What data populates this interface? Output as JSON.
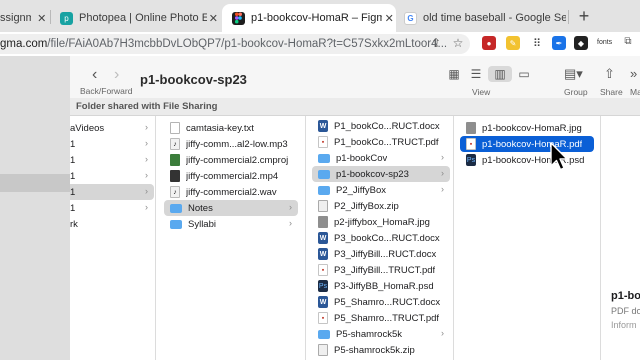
{
  "browser": {
    "tabs": [
      {
        "title": "ssignm",
        "favicon": "page-icon",
        "active": false
      },
      {
        "title": "Photopea | Online Photo Editor",
        "favicon": "photopea-icon",
        "active": false
      },
      {
        "title": "p1-bookcov-HomaR – Figma",
        "favicon": "figma-icon",
        "active": true
      },
      {
        "title": "old time baseball - Google Sea",
        "favicon": "google-icon",
        "active": false
      }
    ],
    "close_glyph": "✕",
    "new_tab_glyph": "+",
    "address": {
      "host": "gma.com",
      "path": "/file/FAiA0Ab7H3mcbbDvLObQP7/p1-bookcov-HomaR?t=C57Sxkx2mLtoor4..."
    },
    "fonts_label": "fonts"
  },
  "finder": {
    "window_title": "p1-bookcov-sp23",
    "back_forward_label": "Back/Forward",
    "view_label": "View",
    "group_label": "Group",
    "share_label": "Share",
    "more_label": "Ma",
    "shared_banner": "Folder shared with File Sharing",
    "sidebar_items": [
      "aVideos",
      "1",
      "1",
      "1",
      "1",
      "1",
      "rk"
    ],
    "column1": [
      {
        "name": "camtasia-key.txt",
        "icon": "text-file-icon"
      },
      {
        "name": "jiffy-comm...al2-low.mp3",
        "icon": "audio-file-icon"
      },
      {
        "name": "jiffy-commercial2.cmproj",
        "icon": "project-file-icon"
      },
      {
        "name": "jiffy-commercial2.mp4",
        "icon": "video-file-icon"
      },
      {
        "name": "jiffy-commercial2.wav",
        "icon": "audio-file-icon"
      },
      {
        "name": "Notes",
        "icon": "folder-icon",
        "folder": true,
        "state": "gray"
      },
      {
        "name": "Syllabi",
        "icon": "folder-icon",
        "folder": true
      }
    ],
    "column2": [
      {
        "name": "P1_bookCo...RUCT.docx",
        "icon": "word-file-icon"
      },
      {
        "name": "P1_bookCo...TRUCT.pdf",
        "icon": "pdf-file-icon"
      },
      {
        "name": "p1-bookCov",
        "icon": "folder-icon",
        "folder": true
      },
      {
        "name": "p1-bookcov-sp23",
        "icon": "folder-icon",
        "folder": true,
        "state": "gray"
      },
      {
        "name": "P2_JiffyBox",
        "icon": "folder-icon",
        "folder": true
      },
      {
        "name": "P2_JiffyBox.zip",
        "icon": "zip-file-icon"
      },
      {
        "name": "p2-jiffybox_HomaR.jpg",
        "icon": "image-file-icon"
      },
      {
        "name": "P3_bookCo...RUCT.docx",
        "icon": "word-file-icon"
      },
      {
        "name": "P3_JiffyBill...RUCT.docx",
        "icon": "word-file-icon"
      },
      {
        "name": "P3_JiffyBill...TRUCT.pdf",
        "icon": "pdf-file-icon"
      },
      {
        "name": "P3-JiffyBB_HomaR.psd",
        "icon": "psd-file-icon"
      },
      {
        "name": "P5_Shamro...RUCT.docx",
        "icon": "word-file-icon"
      },
      {
        "name": "P5_Shamro...TRUCT.pdf",
        "icon": "pdf-file-icon"
      },
      {
        "name": "P5-shamrock5k",
        "icon": "folder-icon",
        "folder": true
      },
      {
        "name": "P5-shamrock5k.zip",
        "icon": "zip-file-icon"
      }
    ],
    "column3": [
      {
        "name": "p1-bookcov-HomaR.jpg",
        "icon": "image-file-icon"
      },
      {
        "name": "p1-bookcov-HomaR.pdf",
        "icon": "pdf-file-icon",
        "state": "blue"
      },
      {
        "name": "p1-bookcov-HomaR.psd",
        "icon": "psd-file-icon"
      }
    ],
    "preview": {
      "name": "p1-bo",
      "kind": "PDF do",
      "info": "Inform"
    }
  }
}
